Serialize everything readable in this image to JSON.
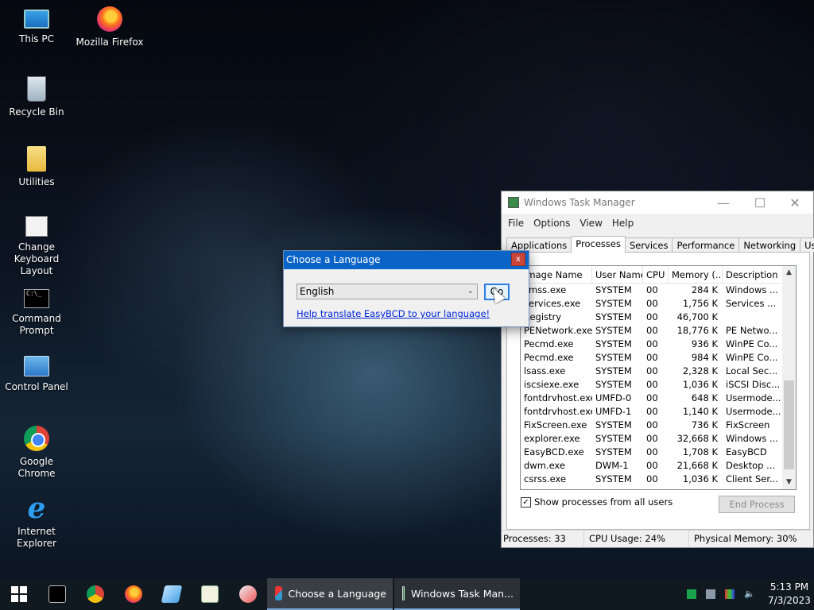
{
  "desktop": {
    "icons": [
      {
        "label": "This PC"
      },
      {
        "label": "Mozilla Firefox"
      },
      {
        "label": "Recycle Bin"
      },
      {
        "label": "Utilities"
      },
      {
        "label": "Change Keyboard Layout"
      },
      {
        "label": "Command Prompt"
      },
      {
        "label": "Control Panel"
      },
      {
        "label": "Google Chrome"
      },
      {
        "label": "Internet Explorer"
      }
    ]
  },
  "taskmgr": {
    "title": "Windows Task Manager",
    "menu": [
      "File",
      "Options",
      "View",
      "Help"
    ],
    "tabs": [
      "Applications",
      "Processes",
      "Services",
      "Performance",
      "Networking",
      "Users"
    ],
    "active_tab": "Processes",
    "columns": [
      "Image Name",
      "User Name",
      "CPU",
      "Memory (...",
      "Description"
    ],
    "rows": [
      [
        "smss.exe",
        "SYSTEM",
        "00",
        "284 K",
        "Windows ..."
      ],
      [
        "services.exe",
        "SYSTEM",
        "00",
        "1,756 K",
        "Services ..."
      ],
      [
        "Registry",
        "SYSTEM",
        "00",
        "46,700 K",
        ""
      ],
      [
        "PENetwork.exe",
        "SYSTEM",
        "00",
        "18,776 K",
        "PE Netwo..."
      ],
      [
        "Pecmd.exe",
        "SYSTEM",
        "00",
        "936 K",
        "WinPE Co..."
      ],
      [
        "Pecmd.exe",
        "SYSTEM",
        "00",
        "984 K",
        "WinPE Co..."
      ],
      [
        "lsass.exe",
        "SYSTEM",
        "00",
        "2,328 K",
        "Local Sec..."
      ],
      [
        "iscsiexe.exe",
        "SYSTEM",
        "00",
        "1,036 K",
        "iSCSI Disc..."
      ],
      [
        "fontdrvhost.exe",
        "UMFD-0",
        "00",
        "648 K",
        "Usermode..."
      ],
      [
        "fontdrvhost.exe",
        "UMFD-1",
        "00",
        "1,140 K",
        "Usermode..."
      ],
      [
        "FixScreen.exe",
        "SYSTEM",
        "00",
        "736 K",
        "FixScreen"
      ],
      [
        "explorer.exe",
        "SYSTEM",
        "00",
        "32,668 K",
        "Windows ..."
      ],
      [
        "EasyBCD.exe",
        "SYSTEM",
        "00",
        "1,708 K",
        "EasyBCD"
      ],
      [
        "dwm.exe",
        "DWM-1",
        "00",
        "21,668 K",
        "Desktop ..."
      ],
      [
        "csrss.exe",
        "SYSTEM",
        "00",
        "1,036 K",
        "Client Ser..."
      ]
    ],
    "show_all_label": "Show processes from all users",
    "show_all_checked": "✓",
    "end_process_label": "End Process",
    "status": {
      "processes": "Processes: 33",
      "cpu": "CPU Usage: 24%",
      "memory": "Physical Memory: 30%"
    }
  },
  "lang_dialog": {
    "title": "Choose a Language",
    "close_label": "x",
    "selected_language": "English",
    "go_label": "Go",
    "help_link": "Help translate EasyBCD to your language!"
  },
  "taskbar": {
    "buttons": [
      {
        "label": "Choose a Language"
      },
      {
        "label": "Windows Task Man..."
      }
    ],
    "clock_time": "5:13 PM",
    "clock_date": "7/3/2023"
  }
}
